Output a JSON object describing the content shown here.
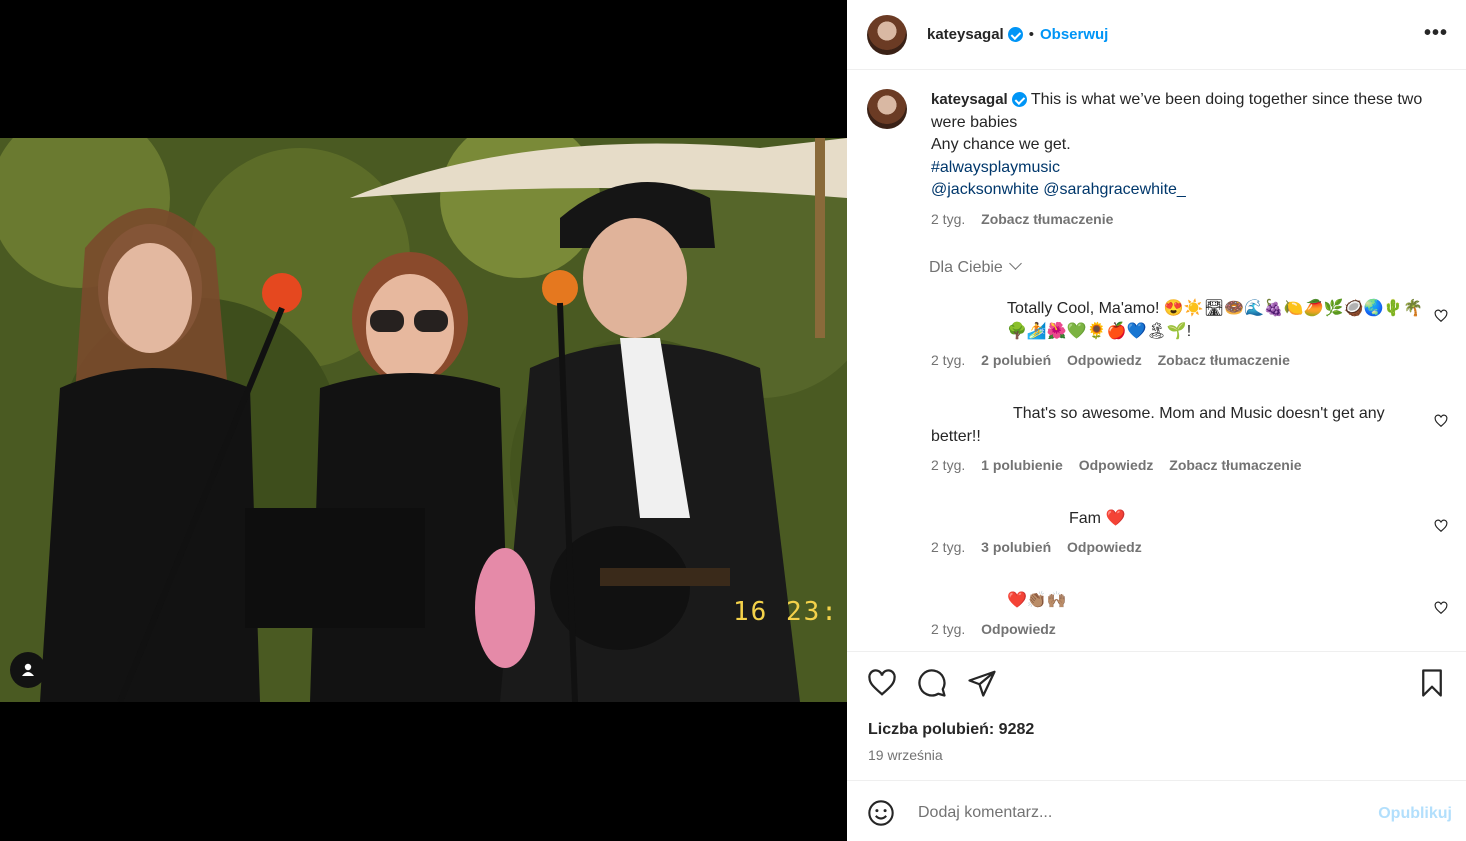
{
  "post": {
    "username": "kateysagal",
    "dot": "•",
    "follow_label": "Obserwuj",
    "more_label": "•••"
  },
  "photo": {
    "timestamp_overlay": "16 23:"
  },
  "caption": {
    "username": "kateysagal",
    "line1": "This is what we’ve been doing together since these two were babies",
    "line2": "Any chance we get.",
    "hashtag": "#alwaysplaymusic",
    "mentions": "@jacksonwhite @sarahgracewhite_",
    "time": "2 tyg.",
    "translate": "Zobacz tłumaczenie"
  },
  "for_you_label": "Dla Ciebie",
  "comments": [
    {
      "text": "Totally Cool, Ma'amo! 😍☀️🛣🍩🌊🍇🍋🥭🌿🥥🌏🌵🌴🌳🏄🌺💚🌻🍎💙🏝🌱!",
      "time": "2 tyg.",
      "likes": "2 polubień",
      "reply": "Odpowiedz",
      "translate": "Zobacz tłumaczenie"
    },
    {
      "text": "That's so awesome. Mom and Music doesn't get any better!!",
      "time": "2 tyg.",
      "likes": "1 polubienie",
      "reply": "Odpowiedz",
      "translate": "Zobacz tłumaczenie"
    },
    {
      "text": "Fam ❤️",
      "time": "2 tyg.",
      "likes": "3 polubień",
      "reply": "Odpowiedz"
    },
    {
      "text": "❤️👏🏽🙌🏽",
      "time": "2 tyg.",
      "reply": "Odpowiedz"
    }
  ],
  "likes_label": "Liczba polubień: 9282",
  "date_label": "19 września",
  "add_comment": {
    "placeholder": "Dodaj komentarz...",
    "post_label": "Opublikuj"
  },
  "colors": {
    "accent": "#0095f6",
    "link": "#00376b",
    "secondary_text": "#737373"
  }
}
